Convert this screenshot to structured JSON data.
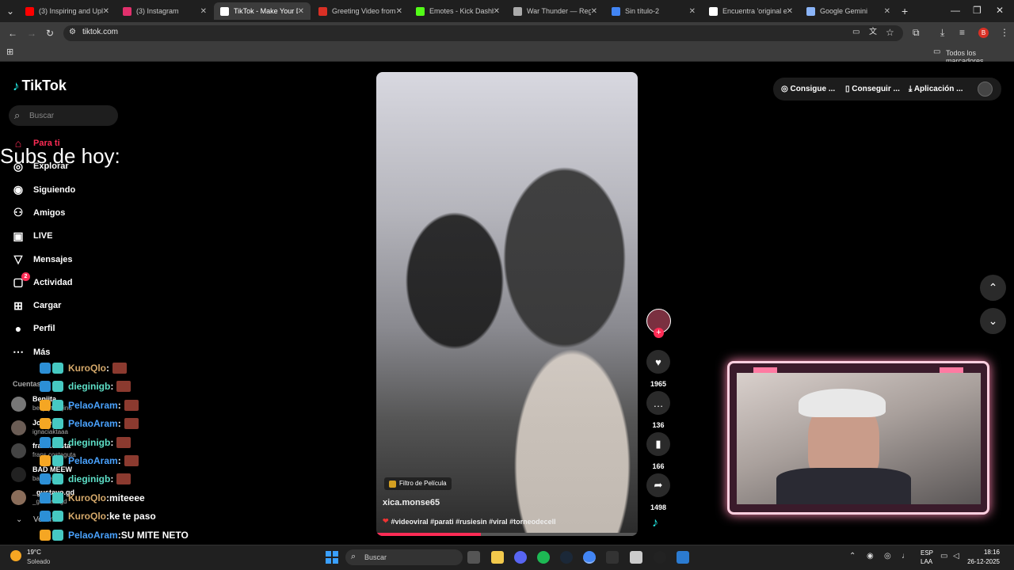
{
  "browser": {
    "tabs": [
      {
        "label": "(3) Inspiring and Upli",
        "color": "#ff0000"
      },
      {
        "label": "(3) Instagram",
        "color": "#e1306c"
      },
      {
        "label": "TikTok - Make Your D",
        "color": "#ffffff"
      },
      {
        "label": "Greeting Video from",
        "color": "#d93025"
      },
      {
        "label": "Emotes - Kick Dashb",
        "color": "#53fc18"
      },
      {
        "label": "War Thunder — Reg",
        "color": "#aaaaaa"
      },
      {
        "label": "Sin título-2",
        "color": "#4285f4"
      },
      {
        "label": "Encuentra 'original e",
        "color": "#ffffff"
      },
      {
        "label": "Google Gemini",
        "color": "#8ab4f8"
      }
    ],
    "url": "tiktok.com",
    "bookmarks_label": "Todos los marcadores"
  },
  "tiktok": {
    "logo": "TikTok",
    "search_placeholder": "Buscar",
    "nav": [
      {
        "label": "Para ti",
        "icon": "home-icon"
      },
      {
        "label": "Explorar",
        "icon": "compass-icon"
      },
      {
        "label": "Siguiendo",
        "icon": "following-icon"
      },
      {
        "label": "Amigos",
        "icon": "friends-icon"
      },
      {
        "label": "LIVE",
        "icon": "live-icon"
      },
      {
        "label": "Mensajes",
        "icon": "messages-icon"
      },
      {
        "label": "Actividad",
        "icon": "activity-icon",
        "badge": "2"
      },
      {
        "label": "Cargar",
        "icon": "upload-icon"
      },
      {
        "label": "Perfil",
        "icon": "profile-icon"
      },
      {
        "label": "Más",
        "icon": "more-icon"
      }
    ],
    "following_header": "Cuentas",
    "following_accounts": [
      {
        "name": "Benjita",
        "handle": "benjaytarejino"
      },
      {
        "name": "Jorge",
        "handle": "ignaciaktaaa"
      },
      {
        "name": "frans.costa",
        "handle": "frans.costaguta"
      },
      {
        "name": "BAD MEEW",
        "handle": "bad meew"
      },
      {
        "name": "_gustavo.gd",
        "handle": "_gustavo.gd"
      }
    ],
    "see_more": "Ver más",
    "top_right": {
      "coins": "Consigue ...",
      "get": "Conseguir ...",
      "app": "Aplicación ..."
    },
    "video": {
      "filter_label": "Filtro de Película",
      "author": "xica.monse65",
      "caption": "#videoviral #parati #rusiesin #viral #torneodecell"
    },
    "actions": {
      "likes": "1965",
      "comments": "136",
      "saves": "166",
      "shares": "1498"
    }
  },
  "overlay": {
    "subs_title": "Subs de hoy:",
    "chat": [
      {
        "user": "KuroQlo",
        "msg": "",
        "user_color": "#d4a86a"
      },
      {
        "user": "dieginigb",
        "msg": "",
        "user_color": "#5ee0c8"
      },
      {
        "user": "PelaoAram",
        "msg": "",
        "user_color": "#4aa3ff"
      },
      {
        "user": "PelaoAram",
        "msg": "",
        "user_color": "#4aa3ff"
      },
      {
        "user": "dieginigb",
        "msg": "",
        "user_color": "#5ee0c8"
      },
      {
        "user": "PelaoAram",
        "msg": "",
        "user_color": "#4aa3ff"
      },
      {
        "user": "dieginigb",
        "msg": "",
        "user_color": "#5ee0c8"
      },
      {
        "user": "KuroQlo",
        "msg": "miteeee",
        "user_color": "#d4a86a"
      },
      {
        "user": "KuroQlo",
        "msg": "ke te paso",
        "user_color": "#d4a86a"
      },
      {
        "user": "PelaoAram",
        "msg": "SU MITE NETO",
        "user_color": "#4aa3ff"
      }
    ]
  },
  "taskbar": {
    "weather_temp": "19°C",
    "weather_desc": "Soleado",
    "search": "Buscar",
    "lang1": "ESP",
    "lang2": "LAA",
    "time": "18:16",
    "date": "26-12-2025"
  }
}
